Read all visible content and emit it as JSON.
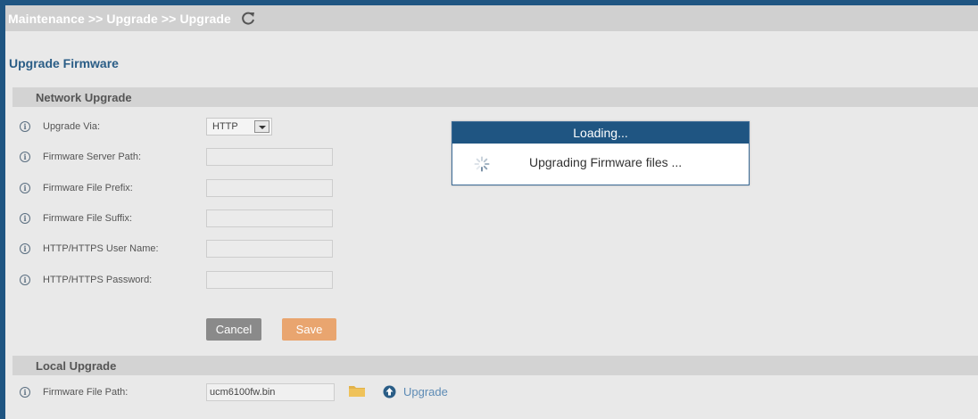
{
  "breadcrumb": {
    "text": "Maintenance >> Upgrade >> Upgrade",
    "refresh_icon": "refresh-icon"
  },
  "page_title": "Upgrade Firmware",
  "network_upgrade": {
    "heading": "Network Upgrade",
    "fields": {
      "upgrade_via": {
        "label": "Upgrade Via:",
        "value": "HTTP"
      },
      "server_path": {
        "label": "Firmware Server Path:",
        "value": ""
      },
      "file_prefix": {
        "label": "Firmware File Prefix:",
        "value": ""
      },
      "file_suffix": {
        "label": "Firmware File Suffix:",
        "value": ""
      },
      "user_name": {
        "label": "HTTP/HTTPS User Name:",
        "value": ""
      },
      "password": {
        "label": "HTTP/HTTPS Password:",
        "value": ""
      }
    },
    "buttons": {
      "cancel": "Cancel",
      "save": "Save"
    }
  },
  "local_upgrade": {
    "heading": "Local Upgrade",
    "file_path_label": "Firmware File Path:",
    "file_path_value": "ucm6100fw.bin",
    "upgrade_link": "Upgrade"
  },
  "loading_dialog": {
    "title": "Loading...",
    "message": "Upgrading Firmware files ..."
  },
  "icons": {
    "info": "i",
    "folder": "folder-icon",
    "upload": "upload-icon",
    "spinner": "spinner-icon"
  },
  "colors": {
    "brand_blue": "#1f5582",
    "title_blue": "#2a5d86",
    "save_orange": "#e9a56f",
    "cancel_gray": "#8a8a8a"
  }
}
